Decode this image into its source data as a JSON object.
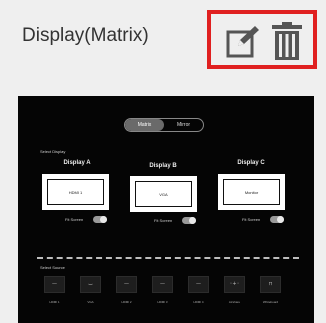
{
  "card": {
    "title": "Display(Matrix)",
    "edit_icon": "edit-icon",
    "delete_icon": "trash-icon",
    "highlight_color": "#e02020"
  },
  "preview": {
    "tabs": [
      "Matrix",
      "Mirror"
    ],
    "active_tab": "Matrix",
    "display_section_label": "Select Display",
    "source_section_label": "Select Source",
    "displays": [
      {
        "label": "Display A",
        "source": "HDMI 1",
        "toggle_label": "Fit Screen"
      },
      {
        "label": "Display B",
        "source": "VGA",
        "toggle_label": "Fit Screen"
      },
      {
        "label": "Display C",
        "source": "Monitor",
        "toggle_label": "Fit Screen"
      }
    ],
    "sources": [
      {
        "icon": "dash-icon",
        "caption": "HDMI 1"
      },
      {
        "icon": "vga-icon",
        "caption": "VGA"
      },
      {
        "icon": "dash-icon",
        "caption": "HDMI 2"
      },
      {
        "icon": "dash-icon",
        "caption": "HDMI 3"
      },
      {
        "icon": "dash-icon",
        "caption": "HDMI 4"
      },
      {
        "icon": "share-icon",
        "caption": "Airshare"
      },
      {
        "icon": "whiteboard-icon",
        "caption": "Whiteboard"
      }
    ]
  }
}
